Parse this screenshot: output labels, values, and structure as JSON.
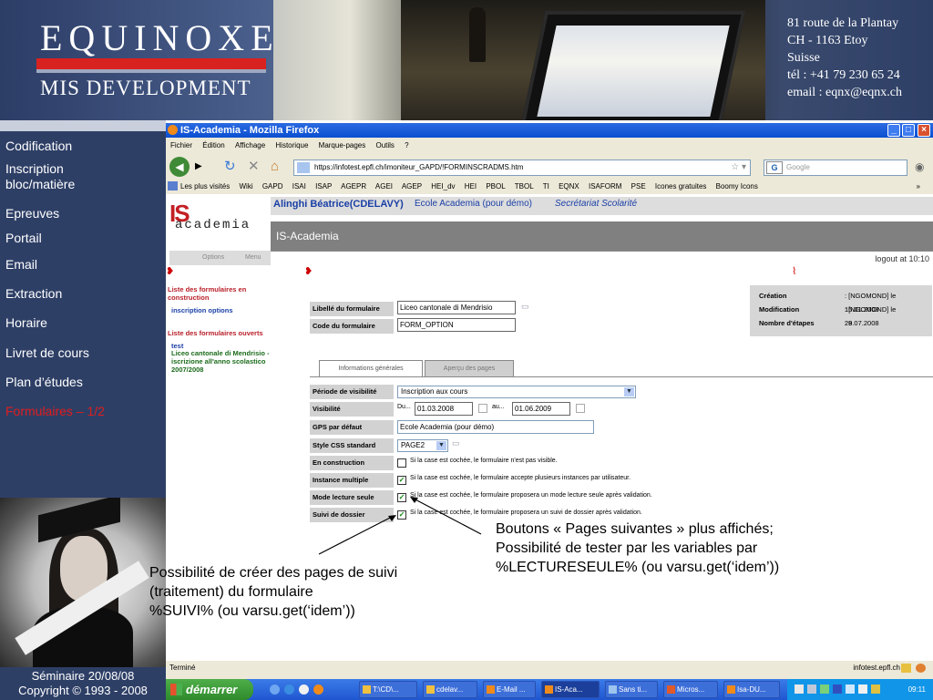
{
  "banner": {
    "logo_line1": "EQUINOXE",
    "logo_line2": "MIS DEVELOPMENT",
    "address": [
      "81 route de la Plantay",
      "CH - 1163 Etoy",
      "Suisse",
      "tél : +41 79 230 65 24",
      "email : eqnx@eqnx.ch"
    ]
  },
  "sidebar": {
    "items": [
      {
        "label": "Codification"
      },
      {
        "label": "Inscription"
      },
      {
        "label": "bloc/matière"
      },
      {
        "label": "Epreuves"
      },
      {
        "label": "Portail"
      },
      {
        "label": "Email"
      },
      {
        "label": "Extraction"
      },
      {
        "label": "Horaire"
      },
      {
        "label": "Livret de cours"
      },
      {
        "label": "Plan d’études"
      },
      {
        "label": "Formulaires – 1/2"
      }
    ],
    "footer_line1": "Séminaire 20/08/08",
    "footer_line2": "Copyright © 1993 - 2008"
  },
  "browser": {
    "title": "IS-Academia - Mozilla Firefox",
    "menu": [
      "Fichier",
      "Édition",
      "Affichage",
      "Historique",
      "Marque-pages",
      "Outils",
      "?"
    ],
    "url": "https://infotest.epfl.ch/imoniteur_GAPD/!FORMINSCRADMS.htm",
    "search_placeholder": "Google",
    "bookmarks": [
      "Les plus visités",
      "Wiki",
      "GAPD",
      "ISAI",
      "ISAP",
      "AGEPR",
      "AGEI",
      "AGEP",
      "HEI_dv",
      "HEI",
      "PBOL",
      "TBOL",
      "TI",
      "EQNX",
      "ISAFORM",
      "PSE",
      "Icones gratuites",
      "Boomy Icons"
    ],
    "status_left": "Terminé",
    "status_right": "infotest.epfl.ch"
  },
  "app": {
    "user": "Alinghi Béatrice(CDELAVY)",
    "school": "Ecole Academia (pour démo)",
    "role": "Secrétariat Scolarité",
    "section": "IS-Academia",
    "logout": "logout at 10:10",
    "logo_is": "IS",
    "logo_academia": "academia",
    "tab_options": "Options",
    "tab_menu": "Menu",
    "left": {
      "heading1": "Liste des formulaires en construction",
      "item1": "inscription options",
      "heading2": "Liste des formulaires ouverts",
      "item2_lines": [
        "test",
        "Liceo cantonale di Mendrisio -",
        "iscrizione all'anno scolastico",
        "2007/2008"
      ]
    },
    "form": {
      "libelle_label": "Libellé du formulaire",
      "libelle_value": "Liceo cantonale di Mendrisio",
      "code_label": "Code du formulaire",
      "code_value": "FORM_OPTION",
      "tab_general": "Informations générales",
      "tab_preview": "Aperçu des pages",
      "periode_label": "Période de visibilité",
      "periode_value": "Inscription aux cours",
      "visibilite_label": "Visibilité",
      "du": "Du...",
      "date_from": "01.03.2008",
      "au": "au...",
      "date_to": "01.06.2009",
      "gps_label": "GPS par défaut",
      "gps_value": "Ecole Academia (pour démo)",
      "css_label": "Style CSS standard",
      "css_value": "PAGE2",
      "construction_label": "En construction",
      "construction_text": "Si la case est cochée, le formulaire n'est pas visible.",
      "multiple_label": "Instance multiple",
      "multiple_text": "Si la case est cochée, le formulaire accepte plusieurs instances par utilisateur.",
      "lecture_label": "Mode lecture seule",
      "lecture_text": "Si la case est cochée, le formulaire proposera un mode lecture seule après validation.",
      "suivi_label": "Suivi de dossier",
      "suivi_text": "Si la case est cochée, le formulaire proposera un suivi de dossier après validation."
    },
    "info": {
      "creation_label": "Création",
      "creation_value": ": [NGOMOND] le 15.01.2008",
      "modification_label": "Modification",
      "modification_value": ": [NGOMOND] le 28.07.2008",
      "etapes_label": "Nombre d'étapes",
      "etapes_value": ": 9"
    }
  },
  "taskbar": {
    "start": "démarrer",
    "tasks": [
      "T:\\CD\\...",
      "cdelav...",
      "E-Mail ...",
      "IS-Aca...",
      "Sans ti...",
      "Micros...",
      "Isa-DU..."
    ],
    "clock": "09:11"
  },
  "annotations": {
    "right": [
      "Boutons « Pages suivantes » plus affichés;",
      "Possibilité de tester par les variables par",
      "%LECTURESEULE% (ou varsu.get(‘idem’))"
    ],
    "left": [
      "Possibilité de créer des pages de suivi",
      "(traitement) du formulaire",
      "%SUIVI% (ou varsu.get(‘idem’))"
    ]
  }
}
